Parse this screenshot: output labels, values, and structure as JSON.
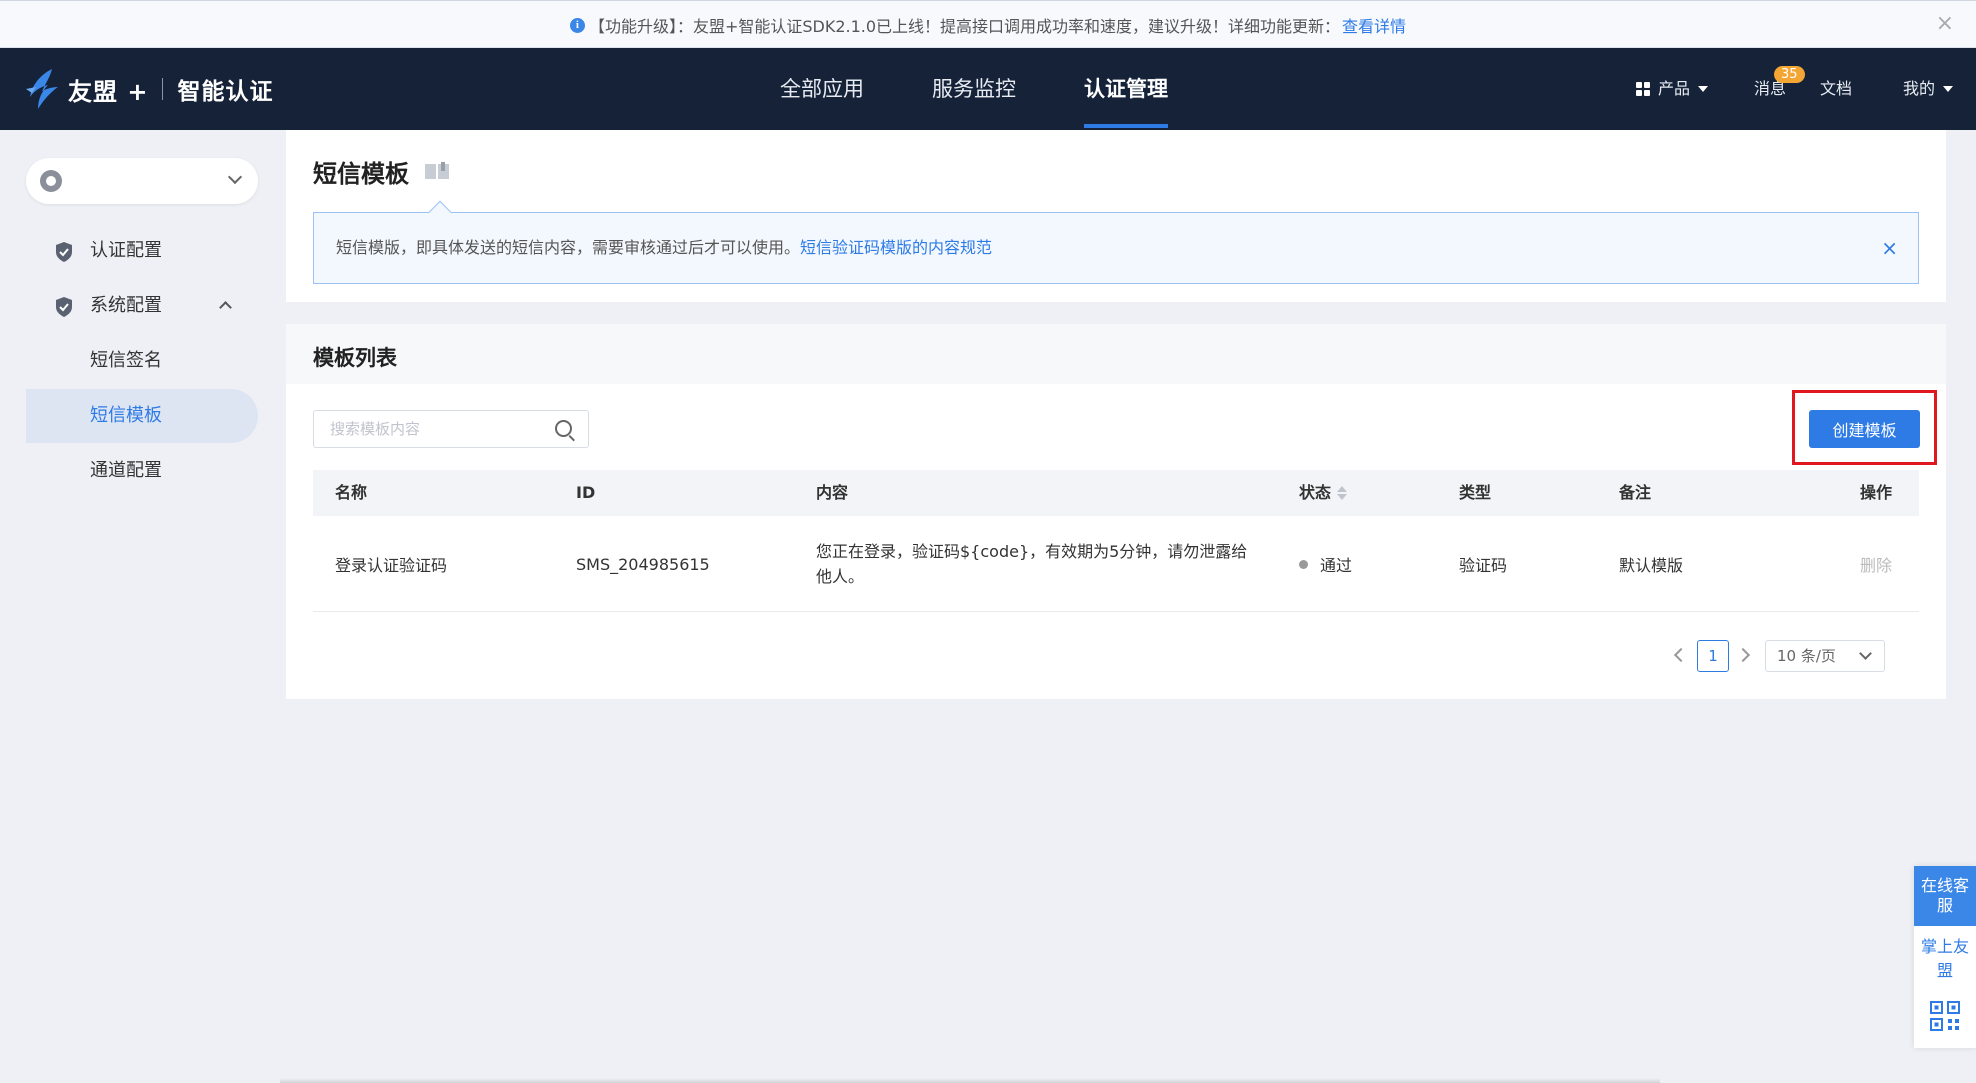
{
  "announcement": {
    "text": "【功能升级】：友盟+智能认证SDK2.1.0已上线！提高接口调用成功率和速度，建议升级！详细功能更新：",
    "link": "查看详情",
    "icon": "info-icon",
    "close": "×"
  },
  "topnav": {
    "brand": "友盟 +",
    "product": "智能认证",
    "tabs": [
      {
        "label": "全部应用"
      },
      {
        "label": "服务监控"
      },
      {
        "label": "认证管理",
        "active": true
      }
    ],
    "right": {
      "products": "产品",
      "messages": "消息",
      "message_badge": "35",
      "docs": "文档",
      "mine": "我的"
    }
  },
  "sidebar": {
    "app_select_icon": "apple-icon",
    "items": [
      {
        "label": "认证配置",
        "icon": "shield-icon"
      },
      {
        "label": "系统配置",
        "icon": "shield-icon",
        "expanded": true
      }
    ],
    "subitems": [
      {
        "label": "短信签名"
      },
      {
        "label": "短信模板",
        "active": true
      },
      {
        "label": "通道配置"
      }
    ]
  },
  "header": {
    "title": "短信模板",
    "notice": "短信模版，即具体发送的短信内容，需要审核通过后才可以使用。",
    "notice_link": "短信验证码模版的内容规范",
    "notice_close": "×"
  },
  "list": {
    "title": "模板列表",
    "search_placeholder": "搜索模板内容",
    "create_button": "创建模板",
    "columns": [
      "名称",
      "ID",
      "内容",
      "状态",
      "类型",
      "备注",
      "操作"
    ],
    "rows": [
      {
        "name": "登录认证验证码",
        "id": "SMS_204985615",
        "content": "您正在登录，验证码${code}，有效期为5分钟，请勿泄露给他人。",
        "status": "通过",
        "type": "验证码",
        "remark": "默认模版",
        "action": "删除"
      }
    ],
    "pagination": {
      "current_page": "1",
      "page_size": "10 条/页"
    }
  },
  "float_widget": {
    "service": "在线客服",
    "mobile": "掌上友盟",
    "qr_icon": "qrcode-icon"
  },
  "colors": {
    "primary": "#2e7be6",
    "nav_bg": "#152238",
    "badge": "#f3a633",
    "highlight": "#e0171e"
  }
}
